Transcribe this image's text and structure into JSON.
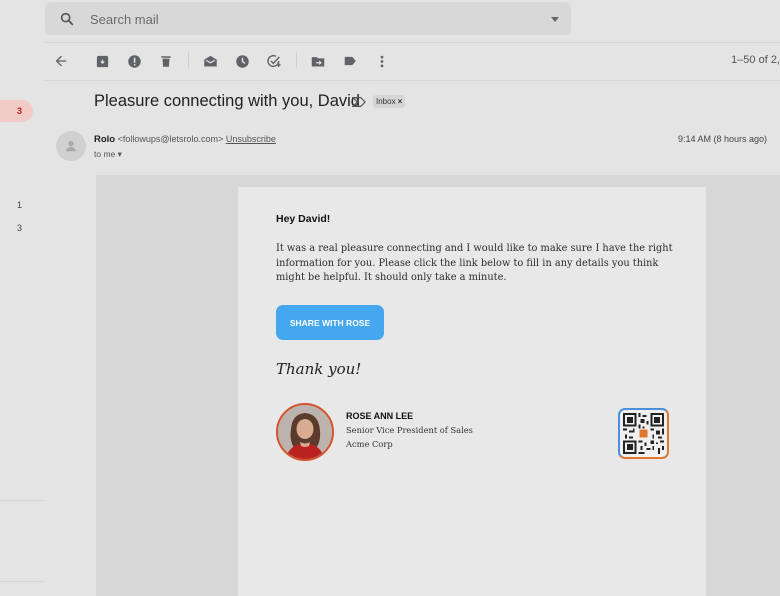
{
  "search": {
    "placeholder": "Search mail"
  },
  "toolbar": {
    "back": "arrow-back-icon",
    "actions": [
      "archive-icon",
      "report-spam-icon",
      "delete-icon",
      "mark-unread-icon",
      "snooze-icon",
      "add-task-icon",
      "move-to-icon",
      "labels-icon",
      "more-icon"
    ],
    "pagination": "1–50 of 2,"
  },
  "nav": {
    "inbox_count": "3",
    "counts": [
      "1",
      "3"
    ]
  },
  "email": {
    "subject": "Pleasure connecting with you, David",
    "label_chip": "Inbox",
    "label_chip_close": "×",
    "sender_name": "Rolo",
    "sender_email": "<followups@letsrolo.com>",
    "unsubscribe": "Unsubscribe",
    "recipient": "to me ▾",
    "timestamp": "9:14 AM (8 hours ago)"
  },
  "body": {
    "greeting": "Hey David!",
    "message": "It was a real pleasure connecting and I would like to make sure I have the right information for you. Please click the link below to fill in any details you think might be helpful. It should only take a minute.",
    "cta_label": "SHARE WITH ROSE",
    "signoff": "Thank you!"
  },
  "signature": {
    "name": "ROSE ANN LEE",
    "title": "Senior Vice President of Sales",
    "company": "Acme Corp"
  },
  "colors": {
    "cta": "#45a8ef",
    "badge": "#f2cbc6",
    "badge_text": "#c5221f",
    "photo_ring": "#d4532a"
  }
}
